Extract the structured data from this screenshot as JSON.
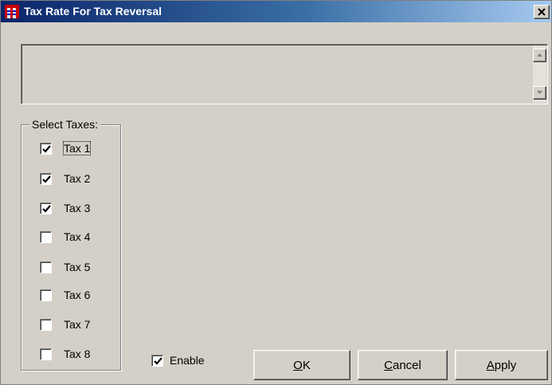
{
  "window": {
    "title": "Tax Rate For Tax Reversal",
    "close_symbol": "x"
  },
  "memo": {
    "value": "",
    "scroll_up_icon": "up-arrow-icon",
    "scroll_down_icon": "down-arrow-icon"
  },
  "taxes_group": {
    "label": "Select Taxes:",
    "items": [
      {
        "label": "Tax 1",
        "checked": true
      },
      {
        "label": "Tax 2",
        "checked": true
      },
      {
        "label": "Tax 3",
        "checked": true
      },
      {
        "label": "Tax 4",
        "checked": false
      },
      {
        "label": "Tax 5",
        "checked": false
      },
      {
        "label": "Tax 6",
        "checked": false
      },
      {
        "label": "Tax 7",
        "checked": false
      },
      {
        "label": "Tax 8",
        "checked": false
      }
    ]
  },
  "enable": {
    "label": "Enable",
    "checked": true
  },
  "buttons": {
    "ok": {
      "mnemonic": "O",
      "rest": "K"
    },
    "cancel": {
      "mnemonic": "C",
      "rest": "ancel"
    },
    "apply": {
      "mnemonic": "A",
      "rest": "pply"
    }
  },
  "colors": {
    "titlebar_start": "#0a246a",
    "titlebar_end": "#a6caf0",
    "face": "#d4d0c8"
  }
}
